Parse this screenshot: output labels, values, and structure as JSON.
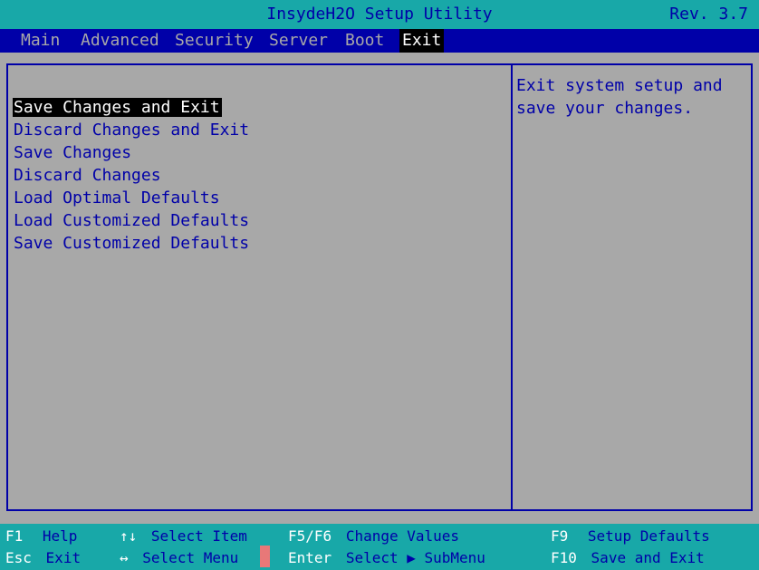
{
  "title": "InsydeH2O Setup Utility",
  "revision": "Rev. 3.7",
  "menu": [
    {
      "label": "Main",
      "active": false
    },
    {
      "label": "Advanced",
      "active": false
    },
    {
      "label": "Security",
      "active": false
    },
    {
      "label": "Server",
      "active": false
    },
    {
      "label": "Boot",
      "active": false
    },
    {
      "label": "Exit",
      "active": true
    }
  ],
  "options": [
    {
      "label": "Save Changes and Exit",
      "selected": true
    },
    {
      "label": "Discard Changes and Exit",
      "selected": false
    },
    {
      "label": "Save Changes",
      "selected": false
    },
    {
      "label": "Discard Changes",
      "selected": false
    },
    {
      "label": "Load Optimal Defaults",
      "selected": false
    },
    {
      "label": "Load Customized Defaults",
      "selected": false
    },
    {
      "label": "Save Customized Defaults",
      "selected": false
    }
  ],
  "help": {
    "line1": "Exit system setup and",
    "line2": "save your changes."
  },
  "footer": {
    "f1_key": "F1",
    "f1_desc": "Help",
    "updown_key": "↑↓",
    "updown_desc": "Select Item",
    "f5f6_key": "F5/F6",
    "f5f6_desc": "Change Values",
    "f9_key": "F9",
    "f9_desc": "Setup Defaults",
    "esc_key": "Esc",
    "esc_desc": "Exit",
    "leftright_key": "↔",
    "leftright_desc": "Select Menu",
    "enter_key": "Enter",
    "enter_desc": "Select ▶ SubMenu",
    "f10_key": "F10",
    "f10_desc": "Save and Exit"
  },
  "colors": {
    "background": "#a8a8a8",
    "bar": "#18a8a8",
    "menubar": "#0000a8",
    "text": "#0000a8",
    "highlight_bg": "#000000",
    "highlight_fg": "#ffffff",
    "cursor": "#e87878"
  }
}
